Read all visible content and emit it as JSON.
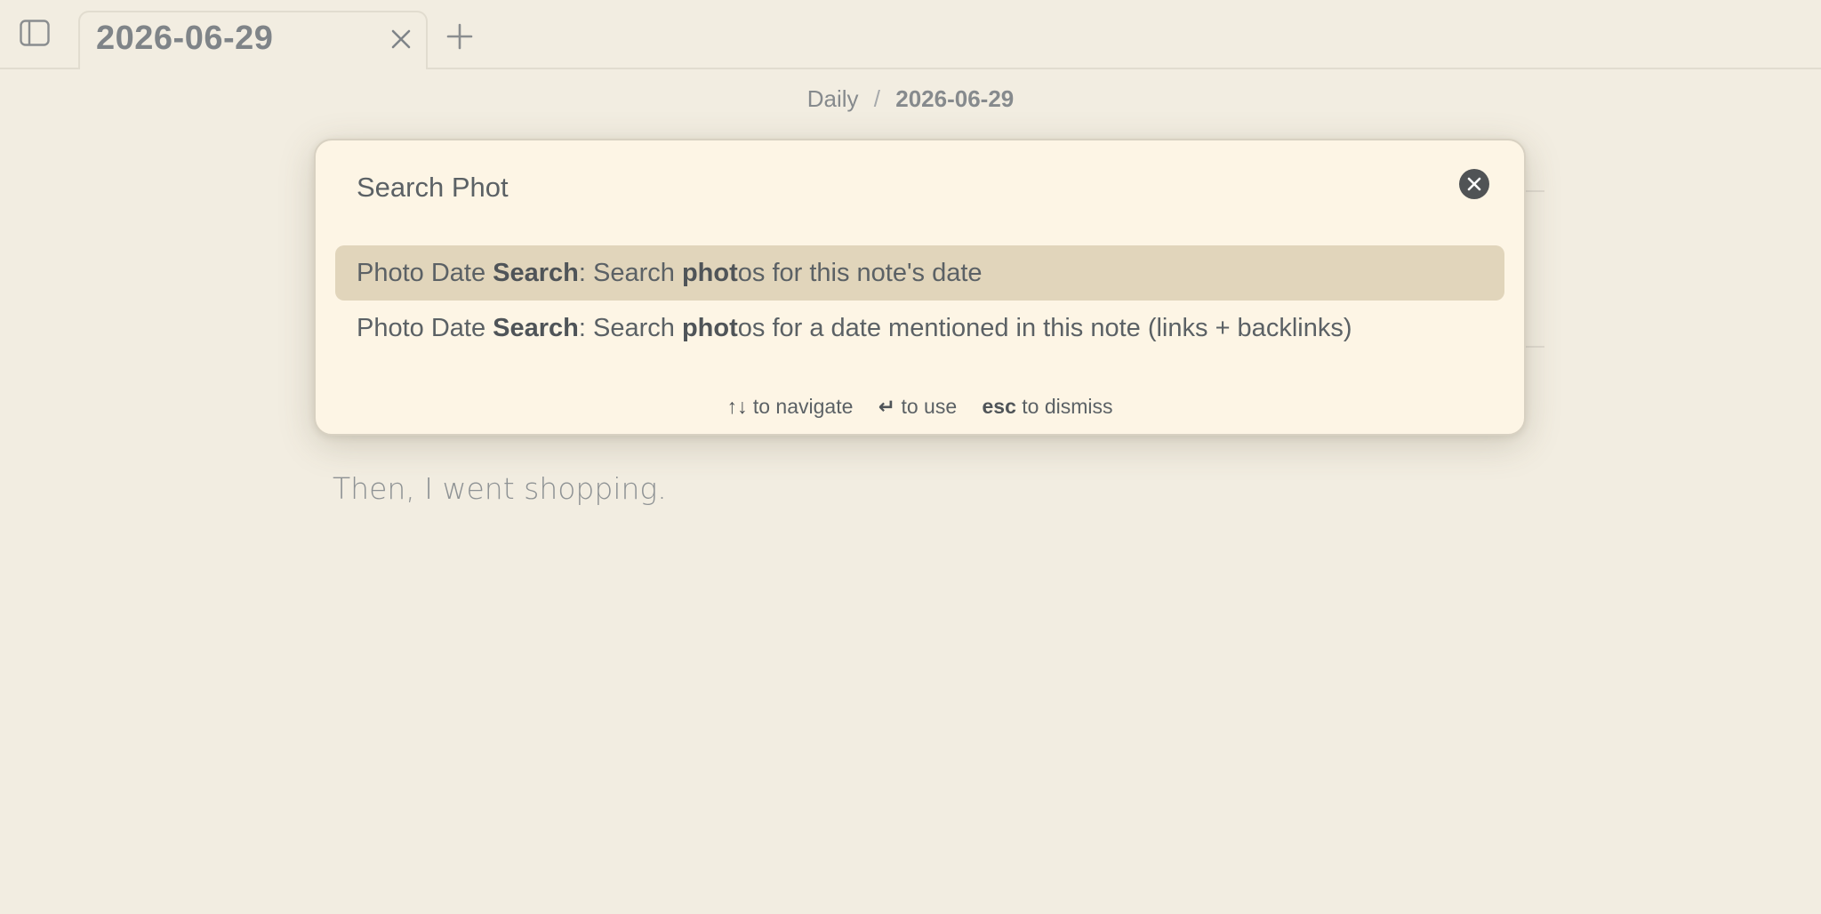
{
  "tab": {
    "title": "2026-06-29"
  },
  "breadcrumb": {
    "parent": "Daily",
    "separator": "/",
    "current": "2026-06-29"
  },
  "note": {
    "visible_line": "Then, I went shopping."
  },
  "palette": {
    "query": "Search Phot",
    "results": [
      {
        "prefix": "Photo Date ",
        "bold1": "Search",
        "mid": ": Search ",
        "bold2": "phot",
        "suffix": "os for this note's date",
        "selected": true
      },
      {
        "prefix": "Photo Date ",
        "bold1": "Search",
        "mid": ": Search ",
        "bold2": "phot",
        "suffix": "os for a date mentioned in this note (links + backlinks)",
        "selected": false
      }
    ],
    "footer": {
      "navigate_key": "↑↓",
      "navigate_label": " to navigate",
      "use_key": "↵",
      "use_label": " to use",
      "dismiss_key": "esc",
      "dismiss_label": " to dismiss"
    }
  },
  "colors": {
    "background": "#f2ede1",
    "palette_bg": "#fdf5e5",
    "selected_row": "#e1d5bb",
    "text": "#5b6165"
  },
  "icons": [
    "sidebar-toggle-icon",
    "close-icon",
    "plus-icon",
    "clear-search-icon"
  ]
}
